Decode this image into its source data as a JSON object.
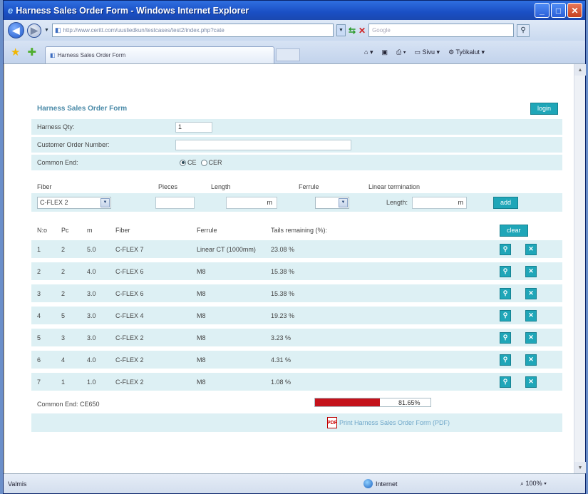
{
  "browser": {
    "title": "Harness Sales Order Form - Windows Internet Explorer",
    "url": "http://www.ceritt.com/uusliedkun/testcases/test2/index.php?cate",
    "search_placeholder": "Google",
    "tab_label": "Harness Sales Order Form",
    "tools": {
      "page": "Sivu",
      "tools": "Työkalut"
    },
    "status": "Valmis",
    "zone": "Internet",
    "zoom": "100%"
  },
  "form": {
    "title": "Harness Sales Order Form",
    "login_label": "login",
    "harness_qty_label": "Harness Qty:",
    "harness_qty_value": "1",
    "customer_order_label": "Customer Order Number:",
    "customer_order_value": "",
    "common_end_label": "Common End:",
    "common_end_options": [
      "CE",
      "CER"
    ],
    "common_end_selected": "CE",
    "columns": {
      "fiber": "Fiber",
      "pieces": "Pieces",
      "length": "Length",
      "ferrule": "Ferrule",
      "linear_termination": "Linear termination"
    },
    "fiber_selected": "C-FLEX 2",
    "length_unit": "m",
    "linear_length_label": "Length:",
    "linear_length_unit": "m",
    "add_label": "add",
    "table": {
      "headers": [
        "N:o",
        "Pc",
        "m",
        "Fiber",
        "Ferrule",
        "Tails remaining (%):"
      ],
      "clear_label": "clear",
      "rows": [
        [
          "1",
          "2",
          "5.0",
          "C-FLEX 7",
          "Linear CT (1000mm)",
          "23.08 %"
        ],
        [
          "2",
          "2",
          "4.0",
          "C-FLEX 6",
          "M8",
          "15.38 %"
        ],
        [
          "3",
          "2",
          "3.0",
          "C-FLEX 6",
          "M8",
          "15.38 %"
        ],
        [
          "4",
          "5",
          "3.0",
          "C-FLEX 4",
          "M8",
          "19.23 %"
        ],
        [
          "5",
          "3",
          "3.0",
          "C-FLEX 2",
          "M8",
          "3.23 %"
        ],
        [
          "6",
          "4",
          "4.0",
          "C-FLEX 2",
          "M8",
          "4.31 %"
        ],
        [
          "7",
          "1",
          "1.0",
          "C-FLEX 2",
          "M8",
          "1.08 %"
        ]
      ]
    },
    "common_end_summary": "Common End: CE650",
    "progress_percent": 81.65,
    "progress_label": "81.65%",
    "pdf_link": "Print Harness Sales Order Form (PDF)"
  }
}
